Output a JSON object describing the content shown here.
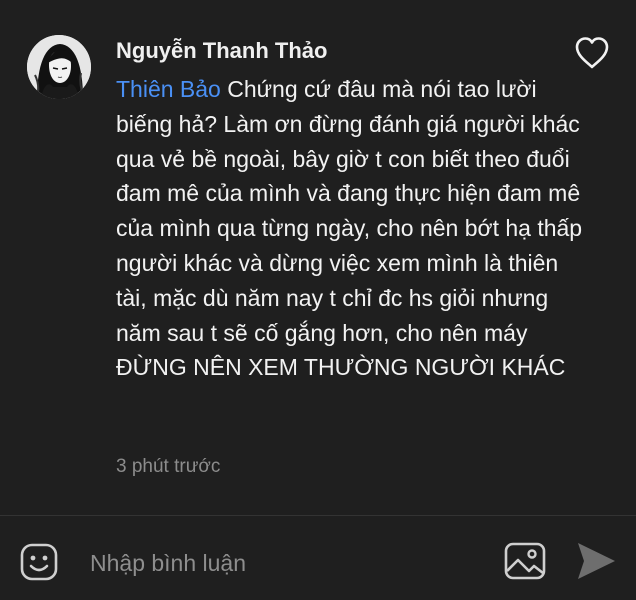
{
  "comment": {
    "author": "Nguyễn Thanh Thảo",
    "mention": "Thiên Bảo",
    "text": " Chứng cứ đâu mà nói tao lười biếng hả? Làm ơn đừng đánh giá người khác qua vẻ bề ngoài, bây giờ t con biết theo đuổi đam mê của mình và đang thực hiện đam mê của mình qua từng ngày, cho nên bớt hạ thấp người khác và dừng việc xem mình là thiên tài, mặc dù năm nay t chỉ đc hs giỏi nhưng năm sau t sẽ cố gắng hơn, cho nên máy ĐỪNG NÊN XEM THƯỜNG NGƯỜI KHÁC",
    "time": "3 phút trước",
    "like_icon": "heart-outline-icon"
  },
  "composer": {
    "placeholder": "Nhập bình luận",
    "value": "",
    "emoji_icon": "emoji-icon",
    "image_icon": "image-icon",
    "send_icon": "send-icon"
  },
  "colors": {
    "background": "#1f1f1f",
    "mention": "#4a90f5",
    "meta_text": "#8c8c8c"
  }
}
